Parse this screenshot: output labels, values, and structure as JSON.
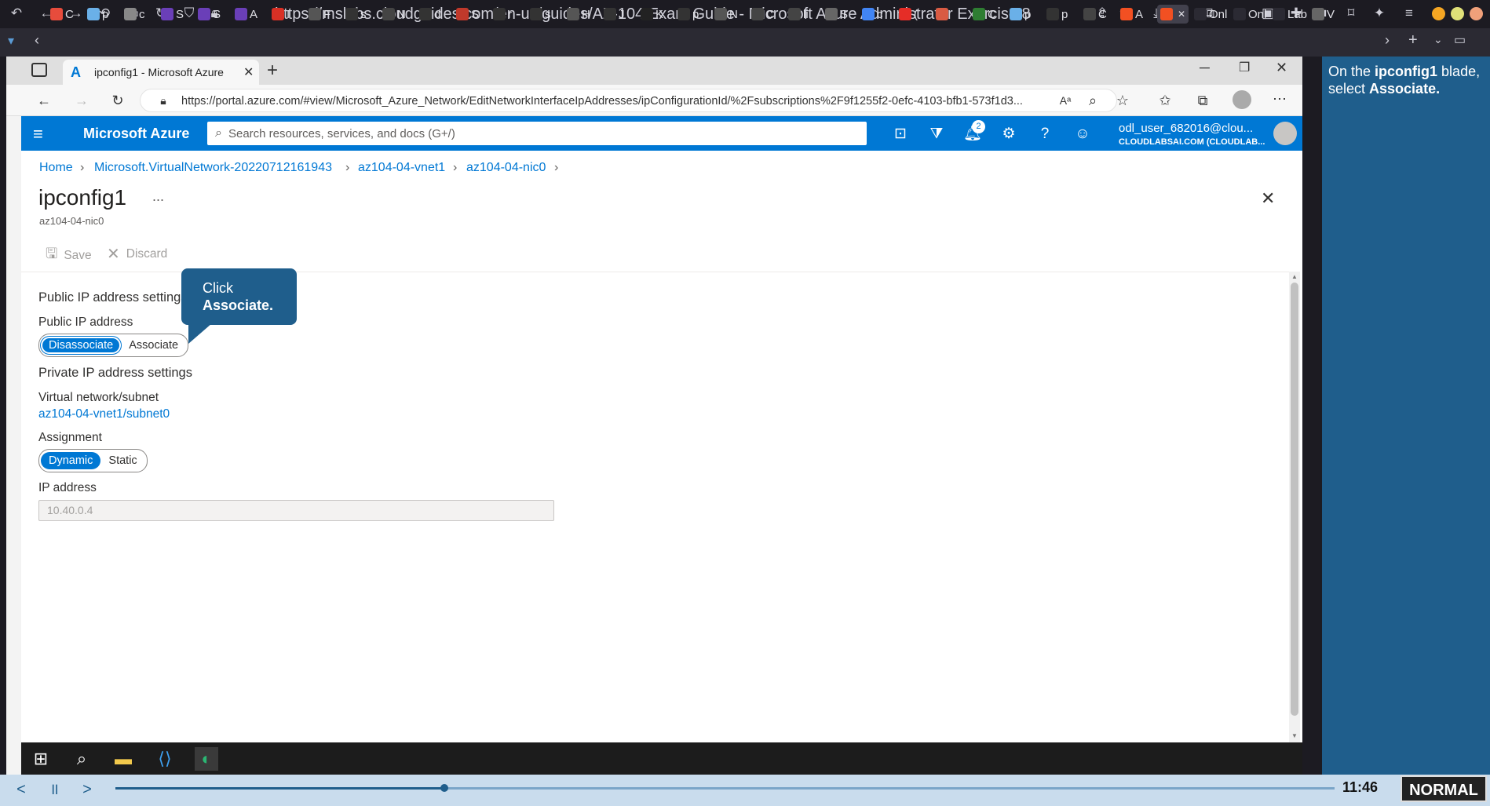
{
  "outer_browser": {
    "url": "https://mslabs.cloudguides.com/en-us/guides/AZ-104 Exam Guide - Microsoft Azure Administrator Exercise 8",
    "tabs": [
      {
        "label": "C",
        "color": "#e74c3c"
      },
      {
        "label": "p",
        "color": "#6ab0e8"
      },
      {
        "label": "c",
        "color": "#888888"
      },
      {
        "label": "S",
        "color": "#6a3fb8"
      },
      {
        "label": "S",
        "color": "#6a3fb8"
      },
      {
        "label": "A",
        "color": "#6a3fb8"
      },
      {
        "label": "I",
        "color": "#d93025"
      },
      {
        "label": "F",
        "color": "#555555"
      },
      {
        "label": "s",
        "color": "#333333"
      },
      {
        "label": "N",
        "color": "#444444"
      },
      {
        "label": "d",
        "color": "#333333"
      },
      {
        "label": "S",
        "color": "#c0392b"
      },
      {
        "label": "r",
        "color": "#333333"
      },
      {
        "label": "s",
        "color": "#333333"
      },
      {
        "label": "H",
        "color": "#555555"
      },
      {
        "label": "J",
        "color": "#333333"
      },
      {
        "label": "K",
        "color": "#222222"
      },
      {
        "label": "p",
        "color": "#333333"
      },
      {
        "label": "N",
        "color": "#555555"
      },
      {
        "label": "C",
        "color": "#444444"
      },
      {
        "label": "li",
        "color": "#444444"
      },
      {
        "label": "S",
        "color": "#666666"
      },
      {
        "label": "c",
        "color": "#4285f4"
      },
      {
        "label": "(",
        "color": "#e52d27"
      },
      {
        "label": "",
        "color": "#d95b43"
      },
      {
        "label": "C",
        "color": "#2e7d32"
      },
      {
        "label": "p",
        "color": "#6ab0e8"
      },
      {
        "label": "p",
        "color": "#333333"
      },
      {
        "label": "C",
        "color": "#444444"
      },
      {
        "label": "A",
        "color": "#f25022"
      },
      {
        "label": "",
        "color": "#f25022"
      },
      {
        "label": "Onl",
        "color": "#2b2a33"
      },
      {
        "label": "Onl",
        "color": "#2b2a33"
      },
      {
        "label": "Lab",
        "color": "#2b2a33"
      },
      {
        "label": "V",
        "color": "#666666"
      }
    ]
  },
  "edge": {
    "tab_title": "ipconfig1 - Microsoft Azure",
    "url": "https://portal.azure.com/#view/Microsoft_Azure_Network/EditNetworkInterfaceIpAddresses/ipConfigurationId/%2Fsubscriptions%2F9f1255f2-0efc-4103-bfb1-573f1d3..."
  },
  "azure": {
    "brand": "Microsoft Azure",
    "search_placeholder": "Search resources, services, and docs (G+/)",
    "notification_count": "2",
    "user_name": "odl_user_682016@clou...",
    "user_tenant": "CLOUDLABSAI.COM (CLOUDLAB..."
  },
  "breadcrumb": [
    "Home",
    "Microsoft.VirtualNetwork-20220712161943",
    "az104-04-vnet1",
    "az104-04-nic0"
  ],
  "page": {
    "title": "ipconfig1",
    "subtitle": "az104-04-nic0",
    "more": "...",
    "save_label": "Save",
    "discard_label": "Discard"
  },
  "form": {
    "public_section": "Public IP address settings",
    "public_ip_label": "Public IP address",
    "public_ip_options": {
      "disassociate": "Disassociate",
      "associate": "Associate"
    },
    "private_section": "Private IP address settings",
    "vnet_label": "Virtual network/subnet",
    "vnet_value": "az104-04-vnet1/subnet0",
    "assignment_label": "Assignment",
    "assignment_options": {
      "dynamic": "Dynamic",
      "static": "Static"
    },
    "ip_label": "IP address",
    "ip_value": "10.40.0.4"
  },
  "callout": {
    "line1": "Click",
    "line2": "Associate."
  },
  "guide": {
    "pre": "On the ",
    "bold1": "ipconfig1",
    "mid": " blade, select ",
    "bold2": "Associate."
  },
  "player": {
    "time": "11:46",
    "mode": "NORMAL",
    "progress": 0.27
  },
  "colors": {
    "azure_blue": "#0078d4",
    "guide_blue": "#1f5e8c"
  }
}
